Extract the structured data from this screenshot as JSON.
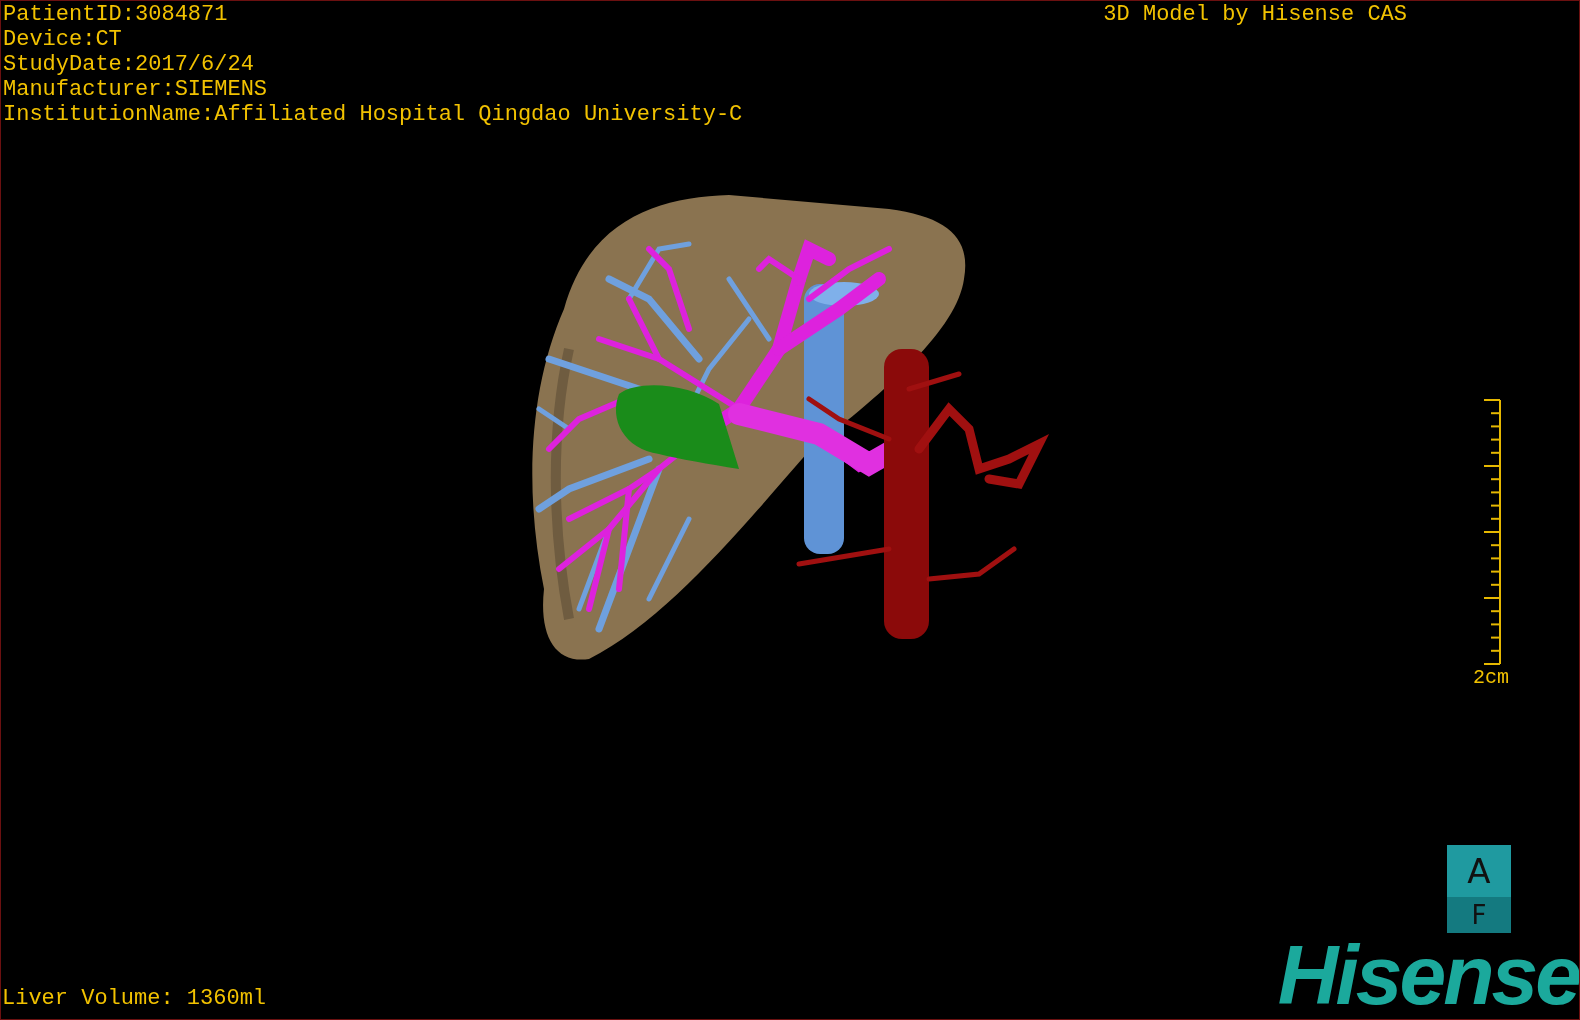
{
  "study_info": [
    "PatientID:3084871",
    "Device:CT",
    "StudyDate:2017/6/24",
    "Manufacturer:SIEMENS",
    "InstitutionName:Affiliated Hospital Qingdao University-C"
  ],
  "title": "3D Model by Hisense CAS",
  "scale_bar": {
    "label": "2cm"
  },
  "orientation_cube": {
    "top": "A",
    "bottom": "F"
  },
  "liver_volume": "Liver Volume: 1360ml",
  "logo": "Hisense"
}
